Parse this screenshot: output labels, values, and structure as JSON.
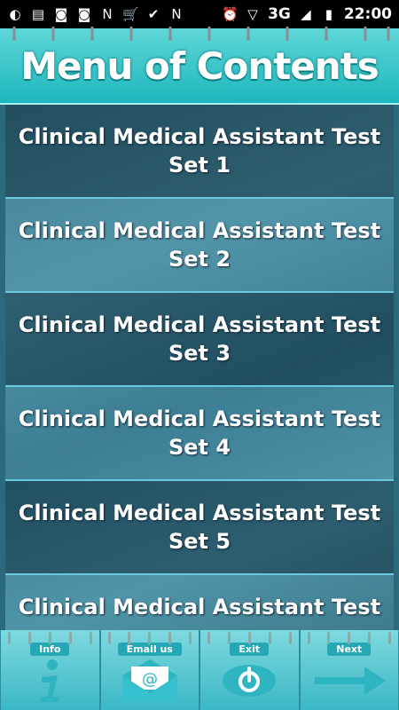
{
  "status_bar": {
    "time": "22:00",
    "network": "3G",
    "left_icons": [
      "moon-icon",
      "message-icon",
      "camera-icon",
      "camera-icon",
      "n-icon",
      "cart-icon",
      "check-icon",
      "n-icon"
    ],
    "right_icons": [
      "alarm-icon",
      "wifi-icon",
      "signal-icon",
      "battery-icon"
    ]
  },
  "header": {
    "title": "Menu of Contents"
  },
  "menu": {
    "items": [
      {
        "line1": "Clinical Medical Assistant Test",
        "line2": "Set 1"
      },
      {
        "line1": "Clinical Medical Assistant Test",
        "line2": "Set 2"
      },
      {
        "line1": "Clinical Medical Assistant Test",
        "line2": "Set 3"
      },
      {
        "line1": "Clinical Medical Assistant Test",
        "line2": "Set 4"
      },
      {
        "line1": "Clinical Medical Assistant Test",
        "line2": "Set 5"
      },
      {
        "line1": "Clinical Medical Assistant Test",
        "line2": ""
      }
    ]
  },
  "toolbar": {
    "info_label": "Info",
    "email_label": "Email us",
    "exit_label": "Exit",
    "next_label": "Next"
  },
  "colors": {
    "accent": "#1db7bd",
    "icon_teal": "#2fb4c2"
  }
}
